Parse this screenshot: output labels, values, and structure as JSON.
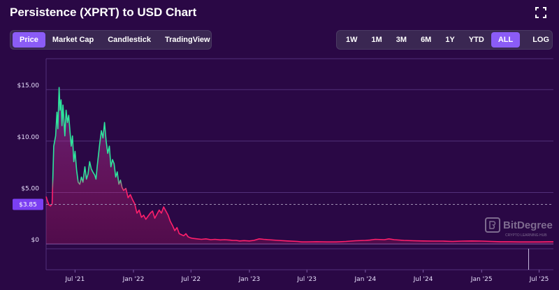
{
  "header": {
    "title": "Persistence (XPRT) to USD Chart"
  },
  "icons": {
    "fullscreen": "fullscreen-icon"
  },
  "chart_types": [
    {
      "label": "Price",
      "active": true
    },
    {
      "label": "Market Cap",
      "active": false
    },
    {
      "label": "Candlestick",
      "active": false
    },
    {
      "label": "TradingView",
      "active": false
    }
  ],
  "ranges": [
    {
      "label": "1W",
      "active": false
    },
    {
      "label": "1M",
      "active": false
    },
    {
      "label": "3M",
      "active": false
    },
    {
      "label": "6M",
      "active": false
    },
    {
      "label": "1Y",
      "active": false
    },
    {
      "label": "YTD",
      "active": false
    },
    {
      "label": "ALL",
      "active": true
    }
  ],
  "log_label": "LOG",
  "current_price_label": "$3.85",
  "watermark": {
    "name": "BitDegree",
    "tagline": "CRYPTO LEARNING HUB"
  },
  "colors": {
    "background": "#2a0845",
    "active_button": "#8b5cf6",
    "line_high": "#2ee59d",
    "line_low": "#ff1f6b",
    "grid": "#52307a"
  },
  "chart_data": {
    "type": "line",
    "title": "Persistence (XPRT) to USD Chart",
    "xlabel": "",
    "ylabel": "",
    "grid": true,
    "xlim": [
      "2021-04-01",
      "2025-08-15"
    ],
    "ylim": [
      -2.5,
      18.0
    ],
    "y_ticks": [
      0,
      5,
      10,
      15
    ],
    "y_tick_labels": [
      "$0",
      "$5.00",
      "$10.00",
      "$15.00"
    ],
    "x_ticks": [
      "2021-07-01",
      "2022-01-01",
      "2022-07-01",
      "2023-01-01",
      "2023-07-01",
      "2024-01-01",
      "2024-07-01",
      "2025-01-01",
      "2025-07-01"
    ],
    "x_tick_labels": [
      "Jul '21",
      "Jan '22",
      "Jul '22",
      "Jan '23",
      "Jul '23",
      "Jan '24",
      "Jul '24",
      "Jan '25",
      "Jul '25"
    ],
    "current_price": 3.85,
    "series": [
      {
        "x": [
          "2021-04-01",
          "2021-04-05",
          "2021-04-10",
          "2021-04-15",
          "2021-04-20",
          "2021-04-25",
          "2021-05-01",
          "2021-05-05",
          "2021-05-08",
          "2021-05-12",
          "2021-05-15",
          "2021-05-18",
          "2021-05-21",
          "2021-05-24",
          "2021-05-27",
          "2021-05-30",
          "2021-06-03",
          "2021-06-07",
          "2021-06-11",
          "2021-06-15",
          "2021-06-19",
          "2021-06-23",
          "2021-06-27",
          "2021-07-01",
          "2021-07-06",
          "2021-07-11",
          "2021-07-16",
          "2021-07-21",
          "2021-07-26",
          "2021-08-01",
          "2021-08-06",
          "2021-08-11",
          "2021-08-16",
          "2021-08-21",
          "2021-08-26",
          "2021-09-01",
          "2021-09-05",
          "2021-09-09",
          "2021-09-13",
          "2021-09-17",
          "2021-09-22",
          "2021-09-27",
          "2021-10-02",
          "2021-10-07",
          "2021-10-12",
          "2021-10-17",
          "2021-10-22",
          "2021-10-27",
          "2021-11-01",
          "2021-11-06",
          "2021-11-11",
          "2021-11-16",
          "2021-11-21",
          "2021-11-26",
          "2021-12-01",
          "2021-12-08",
          "2021-12-15",
          "2021-12-22",
          "2021-12-29",
          "2022-01-05",
          "2022-01-12",
          "2022-01-19",
          "2022-01-26",
          "2022-02-02",
          "2022-02-09",
          "2022-02-16",
          "2022-02-23",
          "2022-03-02",
          "2022-03-09",
          "2022-03-16",
          "2022-03-23",
          "2022-03-30",
          "2022-04-06",
          "2022-04-13",
          "2022-04-20",
          "2022-04-27",
          "2022-05-04",
          "2022-05-11",
          "2022-05-18",
          "2022-05-25",
          "2022-06-01",
          "2022-06-08",
          "2022-06-15",
          "2022-06-22",
          "2022-06-29",
          "2022-07-06",
          "2022-07-20",
          "2022-08-03",
          "2022-08-17",
          "2022-09-01",
          "2022-09-15",
          "2022-10-01",
          "2022-10-15",
          "2022-11-01",
          "2022-11-10",
          "2022-11-20",
          "2022-12-01",
          "2022-12-15",
          "2023-01-01",
          "2023-01-15",
          "2023-02-01",
          "2023-02-15",
          "2023-03-01",
          "2023-04-01",
          "2023-05-01",
          "2023-06-01",
          "2023-06-15",
          "2023-07-01",
          "2023-08-01",
          "2023-09-01",
          "2023-10-01",
          "2023-11-01",
          "2023-12-01",
          "2024-01-01",
          "2024-01-15",
          "2024-02-01",
          "2024-03-01",
          "2024-03-15",
          "2024-04-01",
          "2024-05-01",
          "2024-06-01",
          "2024-07-01",
          "2024-08-01",
          "2024-09-01",
          "2024-10-01",
          "2024-11-01",
          "2024-12-01",
          "2025-01-01",
          "2025-02-01",
          "2025-03-01",
          "2025-04-01",
          "2025-05-01",
          "2025-06-01",
          "2025-07-01",
          "2025-08-01",
          "2025-08-15"
        ],
        "y": [
          4.6,
          4.2,
          3.8,
          3.7,
          3.9,
          9.5,
          10.5,
          12.8,
          11.2,
          15.2,
          13.0,
          14.0,
          11.5,
          13.5,
          12.0,
          10.5,
          13.0,
          11.8,
          12.5,
          11.0,
          9.5,
          10.5,
          8.0,
          9.0,
          7.2,
          6.0,
          5.8,
          6.5,
          6.0,
          7.5,
          6.3,
          6.8,
          8.0,
          7.3,
          7.0,
          6.7,
          6.3,
          7.6,
          8.7,
          9.8,
          11.0,
          10.3,
          11.8,
          10.0,
          8.8,
          9.5,
          7.5,
          8.2,
          7.8,
          6.5,
          7.0,
          5.8,
          6.2,
          5.5,
          5.2,
          5.4,
          4.5,
          4.8,
          4.3,
          3.9,
          3.0,
          3.3,
          2.6,
          2.8,
          2.4,
          2.7,
          3.0,
          3.2,
          2.5,
          2.9,
          3.3,
          3.0,
          3.6,
          3.2,
          2.8,
          2.2,
          1.8,
          1.3,
          1.6,
          1.0,
          0.9,
          0.8,
          1.0,
          0.7,
          0.6,
          0.55,
          0.5,
          0.45,
          0.5,
          0.42,
          0.45,
          0.4,
          0.42,
          0.38,
          0.35,
          0.35,
          0.3,
          0.33,
          0.3,
          0.35,
          0.5,
          0.45,
          0.42,
          0.35,
          0.3,
          0.25,
          0.2,
          0.2,
          0.22,
          0.2,
          0.2,
          0.25,
          0.32,
          0.35,
          0.38,
          0.45,
          0.42,
          0.5,
          0.42,
          0.35,
          0.32,
          0.3,
          0.28,
          0.28,
          0.25,
          0.28,
          0.3,
          0.28,
          0.25,
          0.22,
          0.22,
          0.2,
          0.2,
          0.2,
          0.22,
          0.22
        ]
      }
    ]
  }
}
